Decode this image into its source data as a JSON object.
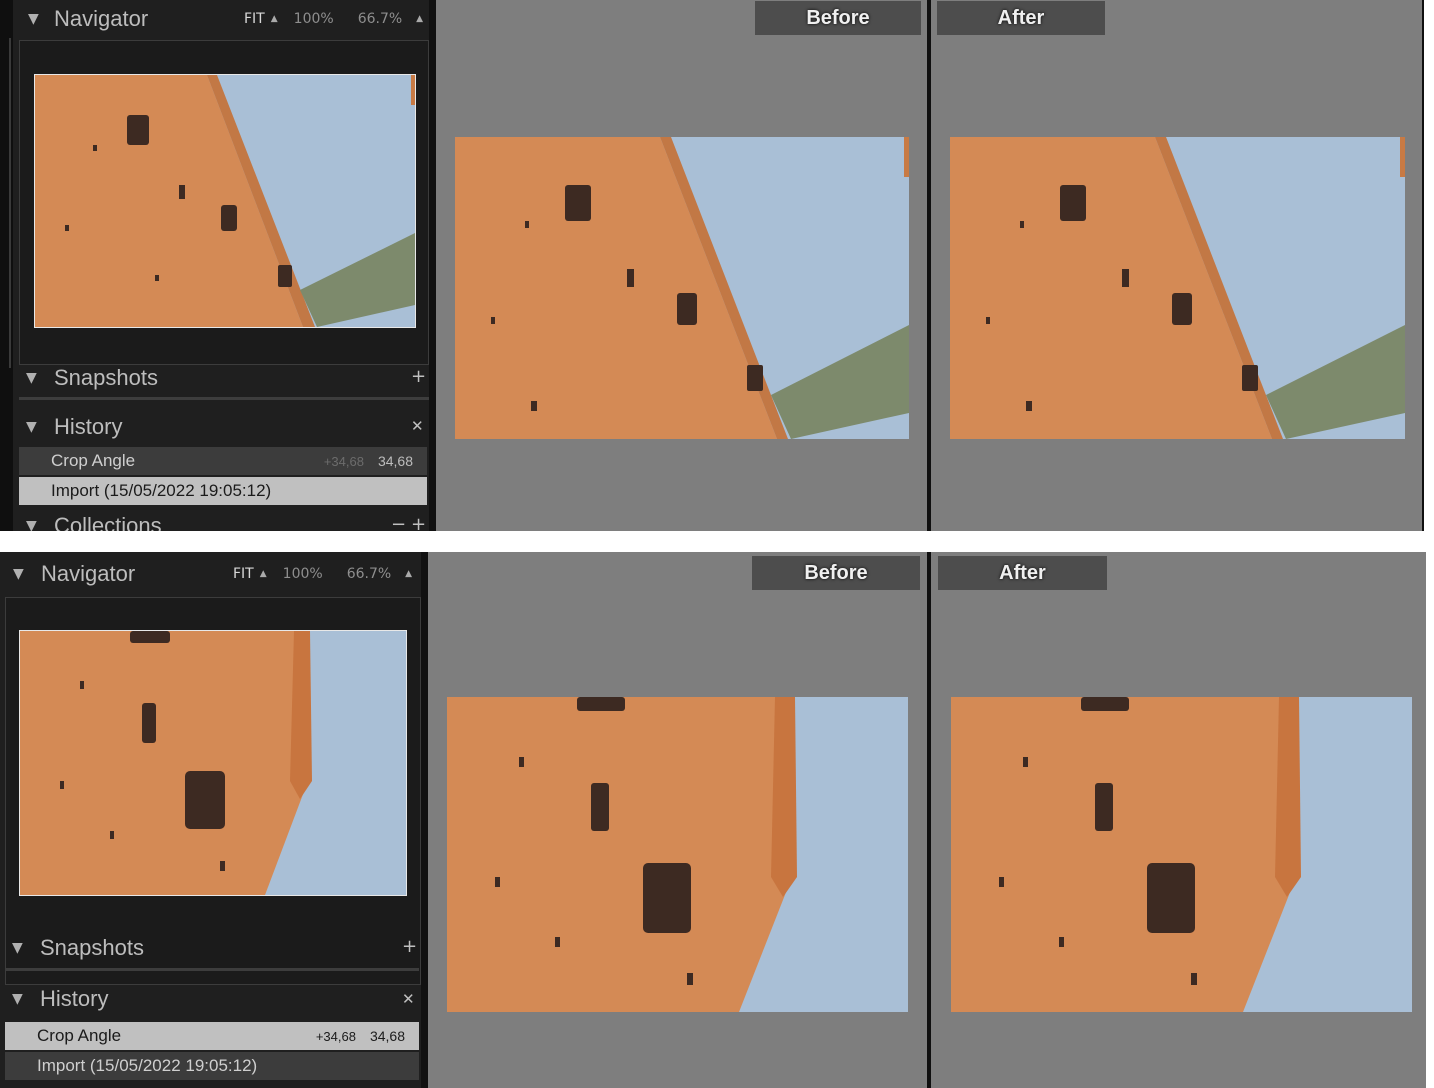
{
  "navigator": {
    "title": "Navigator",
    "zoom_options": [
      "FIT",
      "100%",
      "66.7%"
    ],
    "selected_zoom": "FIT"
  },
  "snapshots": {
    "title": "Snapshots",
    "add_icon": "plus-icon"
  },
  "history": {
    "title": "History",
    "clear_icon": "close-icon",
    "items": [
      {
        "label": "Crop Angle",
        "before": "+34,68",
        "after": "34,68"
      },
      {
        "label": "Import (15/05/2022 19:05:12)"
      }
    ]
  },
  "collections": {
    "title": "Collections"
  },
  "compare": {
    "before_label": "Before",
    "after_label": "After"
  },
  "colors": {
    "panel_bg": "#1f1f1f",
    "view_bg": "#7e7e7e",
    "wall": "#d78e57",
    "sky": "#a9bfd6",
    "roof": "#7d8a6c"
  }
}
